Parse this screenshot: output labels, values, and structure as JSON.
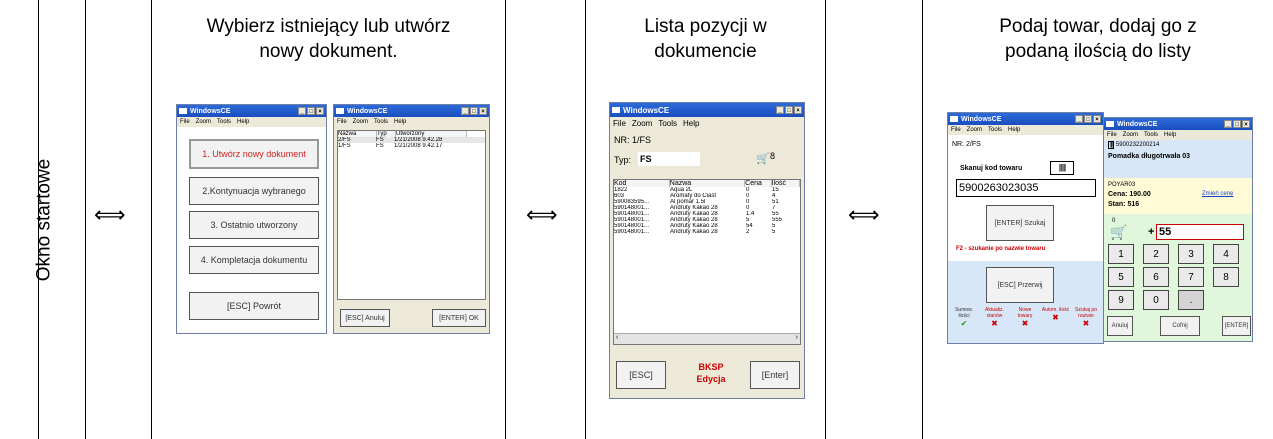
{
  "panel1": {
    "title": "Okno startowe"
  },
  "arrows": [
    "⟺",
    "⟺",
    "⟺"
  ],
  "panel2": {
    "title_line1": "Wybierz istniejący lub utwórz",
    "title_line2": "nowy dokument.",
    "win1": {
      "title": "WindowsCE",
      "menu": [
        "File",
        "Zoom",
        "Tools",
        "Help"
      ],
      "buttons": [
        "1. Utwórz nowy dokument",
        "2.Kontynuacja wybranego",
        "3. Ostatnio utworzony",
        "4. Kompletacja dokumentu",
        "[ESC] Powrót"
      ]
    },
    "win2": {
      "title": "WindowsCE",
      "menu": [
        "File",
        "Zoom",
        "Tools",
        "Help"
      ],
      "columns": [
        "Nazwa",
        "Typ",
        "Utworzony"
      ],
      "rows": [
        [
          "2/FS",
          "FS",
          "1/21/2008 9.42.28"
        ],
        [
          "1/FS",
          "FS",
          "1/21/2008 9.42.17"
        ]
      ],
      "btn_cancel": "[ESC] Anuluj",
      "btn_ok": "[ENTER] OK"
    }
  },
  "panel3": {
    "title_line1": "Lista pozycji w",
    "title_line2": "dokumencie",
    "win": {
      "title": "WindowsCE",
      "menu": [
        "File",
        "Zoom",
        "Tools",
        "Help"
      ],
      "nr": "NR: 1/FS",
      "typ_label": "Typ:",
      "typ_value": "FS",
      "cart_count": "8",
      "columns": [
        "Kod",
        "Nazwa",
        "Cena",
        "Ilość"
      ],
      "rows": [
        [
          "1822",
          "Aqua 2L",
          "0",
          "15"
        ],
        [
          "603",
          "Aromaty do Ciast",
          "0",
          "4"
        ],
        [
          "590083595...",
          "Al pomar 1.5l",
          "0",
          "51"
        ],
        [
          "590148001...",
          "Andruty Kakao 28",
          "0",
          "7"
        ],
        [
          "590148001...",
          "Andruty Kakao 28",
          "1.4",
          "55"
        ],
        [
          "590148001...",
          "Andruty Kakao 28",
          "5",
          "555"
        ],
        [
          "590148001...",
          "Andruty Kakao 28",
          "54",
          "5"
        ],
        [
          "590148001...",
          "Andruty Kakao 28",
          "2",
          "5"
        ]
      ],
      "btn_esc": "[ESC]",
      "bksp_line1": "BKSP",
      "bksp_line2": "Edycja",
      "btn_enter": "[Enter]",
      "accent": "#cc0000"
    }
  },
  "panel4": {
    "title_line1": "Podaj towar, dodaj go z",
    "title_line2": "podaną ilością do listy",
    "win1": {
      "title": "WindowsCE",
      "menu": [
        "File",
        "Zoom",
        "Tools",
        "Help"
      ],
      "nr": "NR: 2/FS",
      "scan_label": "Skanuj kod towaru",
      "barcode_value": "5900263023035",
      "btn_search": "[ENTER] Szukaj",
      "hint": "F2 - szukanie po nazwie towaru",
      "btn_stop": "[ESC] Przerwij",
      "options": [
        {
          "label": "Sumow. ilości",
          "mark": "✔"
        },
        {
          "label": "Aktualiz. stanów",
          "mark": "✖"
        },
        {
          "label": "Nowe towary",
          "mark": "✖"
        },
        {
          "label": "Autom. ilość",
          "mark": "✖"
        },
        {
          "label": "Szukaj po nazwie",
          "mark": "✖"
        }
      ]
    },
    "win2": {
      "title": "WindowsCE",
      "menu": [
        "File",
        "Zoom",
        "Tools",
        "Help"
      ],
      "barcode": "5900232200214",
      "product": "Pomadka długotrwała 03",
      "code": "POYAR03",
      "price": "Cena: 190.00",
      "change_price": "Zmień cenę",
      "stock": "Stan: 516",
      "cart_count": "0",
      "qty_prefix": "+",
      "qty": "55",
      "keys": [
        "1",
        "2",
        "3",
        "4",
        "5",
        "6",
        "7",
        "8",
        "9",
        "0",
        "."
      ],
      "btn_cancel": "Anuluj",
      "btn_back": "Cofnij",
      "btn_enter": "[ENTER]"
    }
  }
}
